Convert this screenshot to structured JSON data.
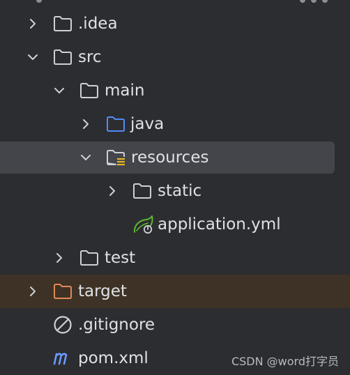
{
  "tree": {
    "items": [
      {
        "label": ".idea",
        "icon": "folder-icon",
        "state": "collapsed"
      },
      {
        "label": "src",
        "icon": "folder-icon",
        "state": "expanded"
      },
      {
        "label": "main",
        "icon": "folder-icon",
        "state": "expanded"
      },
      {
        "label": "java",
        "icon": "source-folder-icon",
        "state": "collapsed"
      },
      {
        "label": "resources",
        "icon": "resources-folder-icon",
        "state": "expanded",
        "selected": true
      },
      {
        "label": "static",
        "icon": "folder-icon",
        "state": "collapsed"
      },
      {
        "label": "application.yml",
        "icon": "spring-config-icon",
        "state": "file"
      },
      {
        "label": "test",
        "icon": "folder-icon",
        "state": "collapsed"
      },
      {
        "label": "target",
        "icon": "excluded-folder-icon",
        "state": "collapsed",
        "excluded": true
      },
      {
        "label": ".gitignore",
        "icon": "gitignore-icon",
        "state": "file"
      },
      {
        "label": "pom.xml",
        "icon": "maven-icon",
        "state": "file"
      }
    ]
  },
  "watermark": "CSDN @word打字员",
  "colors": {
    "background": "#2b2d30",
    "selection": "#43454a",
    "excluded_row": "#3d3225",
    "text": "#dfe1e5",
    "folder_stroke": "#ced0d6",
    "source_folder": "#548af7",
    "excluded_folder": "#e08855",
    "spring": "#5fb832",
    "maven": "#6b9bff"
  }
}
